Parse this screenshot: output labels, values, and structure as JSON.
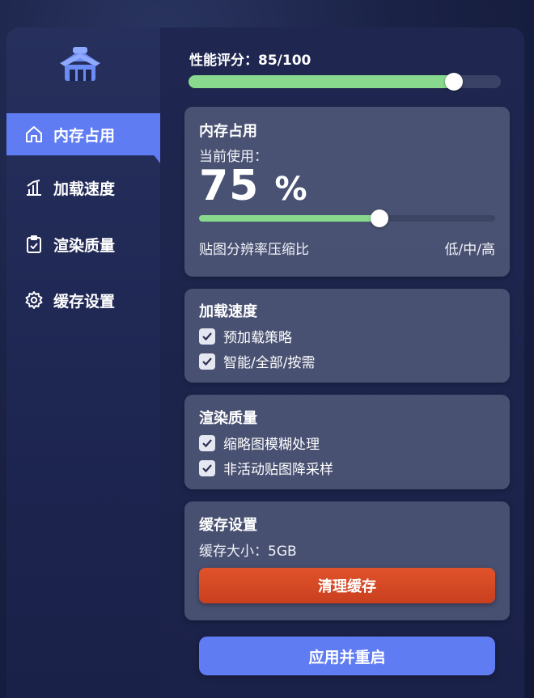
{
  "sidebar": {
    "logo_icon": "house-box-icon",
    "items": [
      {
        "label": "内存占用",
        "icon": "home-icon",
        "active": true
      },
      {
        "label": "加载速度",
        "icon": "chart-icon",
        "active": false
      },
      {
        "label": "渲染质量",
        "icon": "clipboard-icon",
        "active": false
      },
      {
        "label": "缓存设置",
        "icon": "gear-icon",
        "active": false
      }
    ]
  },
  "score": {
    "label": "性能评分：85/100",
    "value": 0.85
  },
  "memory": {
    "title": "内存占用",
    "current_label": "当前使用：",
    "value": "75",
    "unit": "%",
    "slider_value": 0.61,
    "footer_left": "贴图分辨率压缩比",
    "footer_right": "低/中/高"
  },
  "loading": {
    "title": "加载速度",
    "options": [
      {
        "label": "预加载策略",
        "checked": true
      },
      {
        "label": "智能/全部/按需",
        "checked": true
      }
    ]
  },
  "render": {
    "title": "渲染质量",
    "options": [
      {
        "label": "缩略图模糊处理",
        "checked": true
      },
      {
        "label": "非活动贴图降采样",
        "checked": true
      }
    ]
  },
  "cache": {
    "title": "缓存设置",
    "size_label": "缓存大小：5GB",
    "clear_label": "清理缓存"
  },
  "apply_label": "应用并重启",
  "colors": {
    "accent": "#5f7cf2",
    "progress": "#88d98e",
    "danger": "#d84a25"
  }
}
